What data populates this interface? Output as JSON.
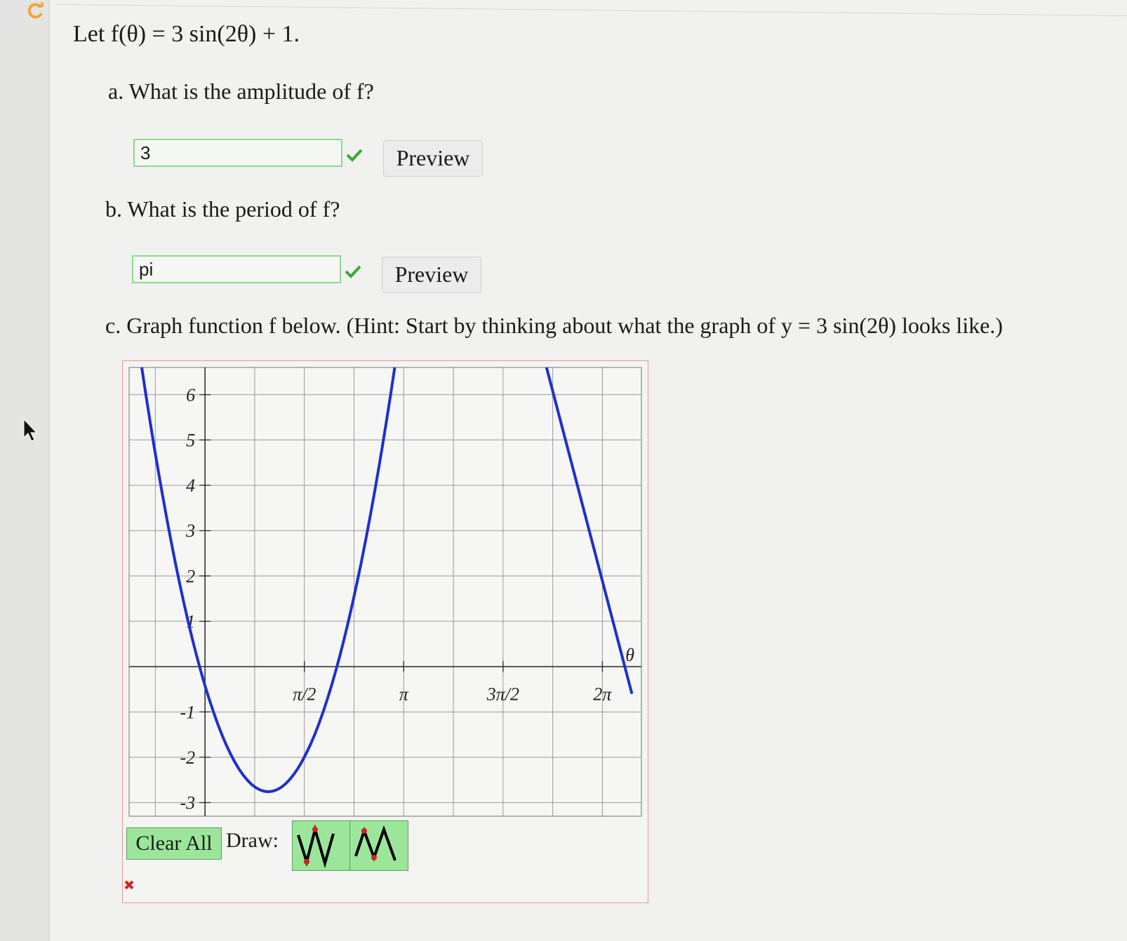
{
  "problem": {
    "statement": "Let f(θ) = 3 sin(2θ) + 1."
  },
  "questions": {
    "a": {
      "prompt": "a. What is the amplitude of f?",
      "answer_value": "3",
      "preview_label": "Preview"
    },
    "b": {
      "prompt": "b. What is the period of f?",
      "answer_value": "pi",
      "preview_label": "Preview"
    },
    "c": {
      "prompt": "c. Graph function f below. (Hint: Start by thinking about what the graph of y = 3 sin(2θ) looks like.)"
    }
  },
  "graph_toolbar": {
    "clear_label": "Clear All",
    "draw_label": "Draw:",
    "tools": [
      "sine-tool-icon",
      "sine-tool-alt-icon"
    ]
  },
  "icons": {
    "refresh": "refresh-icon",
    "cursor": "cursor-icon",
    "correct": "check-icon",
    "incorrect": "x-icon"
  },
  "colors": {
    "curve": "#1f2fd0",
    "correct": "#3aa73a",
    "incorrect": "#d42020",
    "button_green": "#9be69b"
  },
  "chart_data": {
    "type": "line",
    "xlabel": "θ",
    "ylabel": "",
    "x_tick_labels": [
      "π/2",
      "π",
      "3π/2",
      "2π"
    ],
    "x_tick_values": [
      1.5708,
      3.1416,
      4.7124,
      6.2832
    ],
    "y_tick_labels": [
      "6",
      "5",
      "4",
      "3",
      "2",
      "1",
      "-1",
      "-2",
      "-3"
    ],
    "y_tick_values": [
      6,
      5,
      4,
      3,
      2,
      1,
      -1,
      -2,
      -3
    ],
    "xlim": [
      -1.2,
      6.9
    ],
    "ylim": [
      -3.3,
      6.6
    ],
    "grid": true,
    "series": [
      {
        "segments": [
          {
            "x": [
              -1.0,
              1.57,
              3.0
            ],
            "y": [
              6.6,
              -2.0,
              6.6
            ]
          },
          {
            "x": [
              5.4,
              6.75
            ],
            "y": [
              6.6,
              -0.6
            ]
          }
        ]
      }
    ]
  }
}
